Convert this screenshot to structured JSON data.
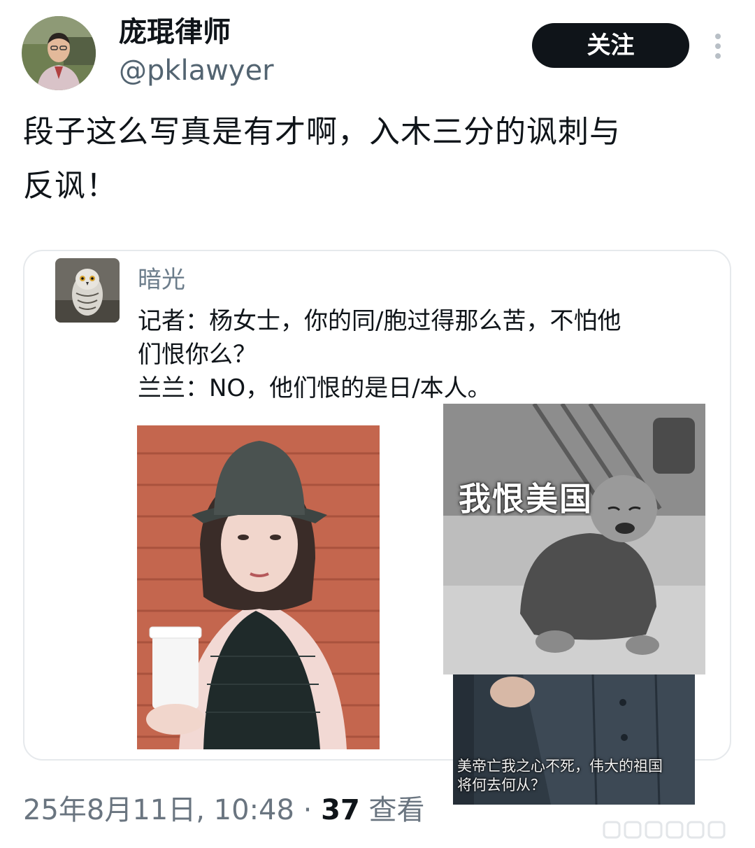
{
  "author": {
    "display_name": "庞琨律师",
    "handle": "@pklawyer"
  },
  "follow_button": {
    "label": "关注"
  },
  "tweet": {
    "text": "段子这么写真是有才啊，入木三分的讽刺与\n反讽！"
  },
  "quoted": {
    "author": "暗光",
    "text": "记者：杨女士，你的同/胞过得那么苦，不怕他\n们恨你么？\n兰兰：NO，他们恨的是日/本人。"
  },
  "images": {
    "child_caption": "我恨美国",
    "man_caption": "美帝亡我之心不死，伟大的祖国\n将何去何从？"
  },
  "meta": {
    "datetime": "25年8月11日, 10:48",
    "separator": "·",
    "views_count": "37",
    "views_label": "查看"
  },
  "colors": {
    "text_primary": "#0f1419",
    "text_secondary": "#536471",
    "button_bg": "#0f1419",
    "card_border": "#e6e9ec"
  }
}
